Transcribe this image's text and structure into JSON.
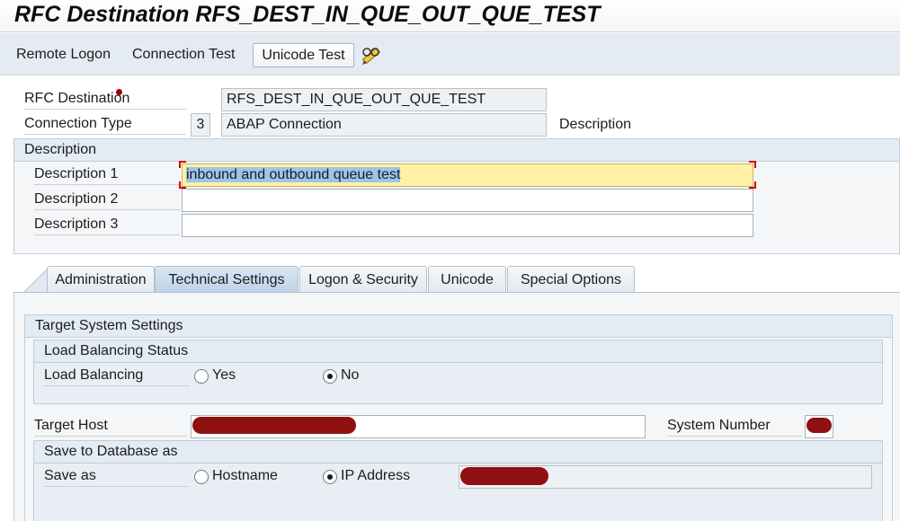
{
  "title": "RFC Destination RFS_DEST_IN_QUE_OUT_QUE_TEST",
  "toolbar": {
    "remote_logon": "Remote Logon",
    "connection_test": "Connection Test",
    "unicode_test": "Unicode Test",
    "edit_icon": "pencil-glasses-icon"
  },
  "header": {
    "rfc_destination_label": "RFC Destination",
    "rfc_destination_value": "RFS_DEST_IN_QUE_OUT_QUE_TEST",
    "connection_type_label": "Connection Type",
    "connection_type_code": "3",
    "connection_type_value": "ABAP Connection",
    "description_label": "Description"
  },
  "description_group": {
    "title": "Description",
    "rows": [
      {
        "label": "Description 1",
        "value": "inbound and outbound queue test"
      },
      {
        "label": "Description 2",
        "value": ""
      },
      {
        "label": "Description 3",
        "value": ""
      }
    ]
  },
  "tabs": [
    {
      "label": "Administration",
      "active": false
    },
    {
      "label": "Technical Settings",
      "active": true
    },
    {
      "label": "Logon & Security",
      "active": false
    },
    {
      "label": "Unicode",
      "active": false
    },
    {
      "label": "Special Options",
      "active": false
    }
  ],
  "target_system": {
    "title": "Target System Settings",
    "load_balancing_status": {
      "title": "Load Balancing Status",
      "label": "Load Balancing",
      "options": [
        {
          "label": "Yes",
          "selected": false
        },
        {
          "label": "No",
          "selected": true
        }
      ]
    },
    "target_host_label": "Target Host",
    "target_host_value": "",
    "system_number_label": "System Number",
    "system_number_value": "",
    "save_to_db": {
      "title": "Save to Database as",
      "label": "Save as",
      "options": [
        {
          "label": "Hostname",
          "selected": false
        },
        {
          "label": "IP Address",
          "selected": true
        }
      ],
      "ip_value": ""
    }
  },
  "colors": {
    "toolbar_bg": "#e4ebf2",
    "group_header_bg": "#e3ebf3",
    "active_tab_bg": "#bdd3e8",
    "focused_field_bg": "#fff1a6",
    "focus_marker": "#d10000",
    "redaction": "#8f1010"
  }
}
